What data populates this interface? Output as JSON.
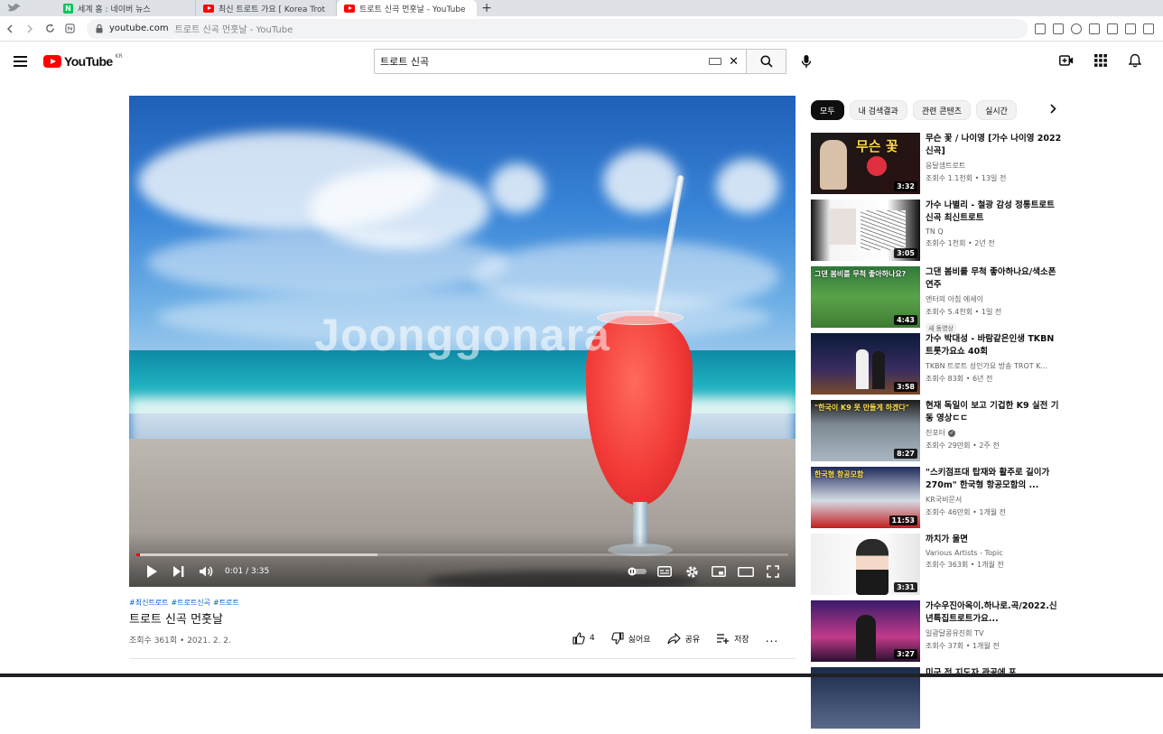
{
  "browser": {
    "tabs": [
      {
        "title": "세계 홈 : 네이버 뉴스",
        "icon": "naver-icon",
        "active": false
      },
      {
        "title": "최신 트로트 가요 [ Korea Trot ",
        "icon": "youtube-favicon-icon",
        "active": false
      },
      {
        "title": "트로트 신곡 먼훗날 - YouTube",
        "icon": "youtube-favicon-icon",
        "active": true
      }
    ],
    "new_tab": "+",
    "url_host": "youtube.com",
    "url_title": "트로트 신곡 먼훗날 - YouTube",
    "naver_letter": "N"
  },
  "header": {
    "logo_text": "YouTube",
    "region": "KR",
    "search_value": "트로트 신곡"
  },
  "player": {
    "watermark": "Joonggonara",
    "current_time": "0:01",
    "duration": "3:35",
    "time_display": "0:01 / 3:35",
    "progress_fraction": 0.005,
    "buffered_fraction": 0.37
  },
  "video": {
    "hashtags": [
      "#최신트로트",
      "#트로트신곡",
      "#트로트"
    ],
    "title": "트로트 신곡 먼훗날",
    "views_date": "조회수 361회 • 2021. 2. 2.",
    "like_count": "4",
    "dislike_label": "싫어요",
    "share_label": "공유",
    "save_label": "저장",
    "more_label": "..."
  },
  "chips": [
    "모두",
    "내 검색결과",
    "관련 콘텐츠",
    "실시간"
  ],
  "recommendations": [
    {
      "title": "무슨 꽃 / 나이영 [가수 나이영 2022 신곡]",
      "channel": "응달샘트로트",
      "stats": "조회수 1.1천회 • 13일 전",
      "duration": "3:32",
      "badge": "",
      "caption": "무슨 꽃",
      "verified": false
    },
    {
      "title": "가수 나별리 - 철광 감성 정통트로트 신곡 최신트로트",
      "channel": "TN Q",
      "stats": "조회수 1천회 • 2년 전",
      "duration": "3:05",
      "badge": "",
      "caption": "",
      "verified": false
    },
    {
      "title": "그댄 봄비를 무척 좋아하나요/색소폰연주",
      "channel": "앤터의 아침 에세이",
      "stats": "조회수 5.4천회 • 1일 전",
      "duration": "4:43",
      "badge": "새 동영상",
      "caption": "그댄 봄비를 무척 좋아하나요?",
      "verified": false
    },
    {
      "title": "가수 박대성 - 바람같은인생 TKBN 트롯가요쇼 40회",
      "channel": "TKBN 트로트 성인가요 방송 TROT K...",
      "stats": "조회수 83회 • 6년 전",
      "duration": "3:58",
      "badge": "",
      "caption": "",
      "verified": false
    },
    {
      "title": "현재 독일이 보고 기겁한 K9 실전 기동 영상ㄷㄷ",
      "channel": "진포터",
      "stats": "조회수 29만회 • 2주 전",
      "duration": "8:27",
      "badge": "",
      "caption": "\"한국이 K9 못 만들게 하겠다\"",
      "verified": true
    },
    {
      "title": "\"스키점프대 탑재와 활주로 길이가 270m\" 한국형 항공모함의 ...",
      "channel": "KR국비문서",
      "stats": "조회수 46만회 • 1개월 전",
      "duration": "11:53",
      "badge": "",
      "caption": "한국형 항공모함",
      "verified": false
    },
    {
      "title": "까치가 울면",
      "channel": "Various Artists - Topic",
      "stats": "조회수 363회 • 1개월 전",
      "duration": "3:31",
      "badge": "",
      "caption": "",
      "verified": false
    },
    {
      "title": "가수우진아옥이.하나로.곡/2022.신년특집트로트가요...",
      "channel": "일광달콩유진회 TV",
      "stats": "조회수 37회 • 1개월 전",
      "duration": "3:27",
      "badge": "",
      "caption": "",
      "verified": false
    },
    {
      "title": "미군 전 지도자 관공에 포",
      "channel": "",
      "stats": "",
      "duration": "",
      "badge": "",
      "caption": "",
      "verified": false
    }
  ],
  "colors": {
    "youtube_red": "#ff0000",
    "link_blue": "#065fd4",
    "text_secondary": "#606060"
  }
}
